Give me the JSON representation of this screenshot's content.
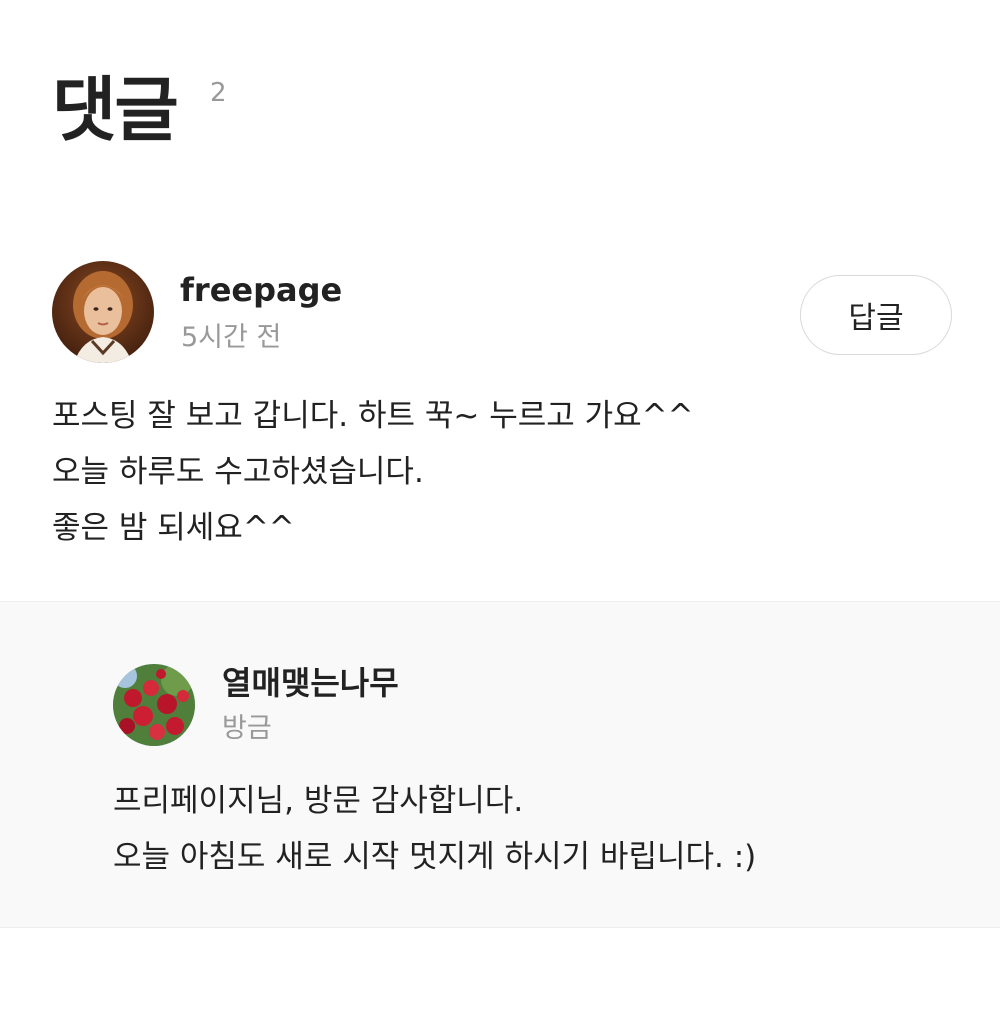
{
  "header": {
    "title": "댓글",
    "count": "2"
  },
  "comments": [
    {
      "author": "freepage",
      "time": "5시간 전",
      "reply_label": "답글",
      "lines": [
        "포스팅 잘 보고 갑니다. 하트 꾹~ 누르고 가요^^",
        "오늘 하루도 수고하셨습니다.",
        "좋은 밤 되세요^^"
      ]
    }
  ],
  "replies": [
    {
      "author": "열매맺는나무",
      "time": "방금",
      "lines": [
        "프리페이지님, 방문 감사합니다.",
        "오늘 아침도 새로 시작 멋지게 하시기 바립니다. :)"
      ]
    }
  ]
}
